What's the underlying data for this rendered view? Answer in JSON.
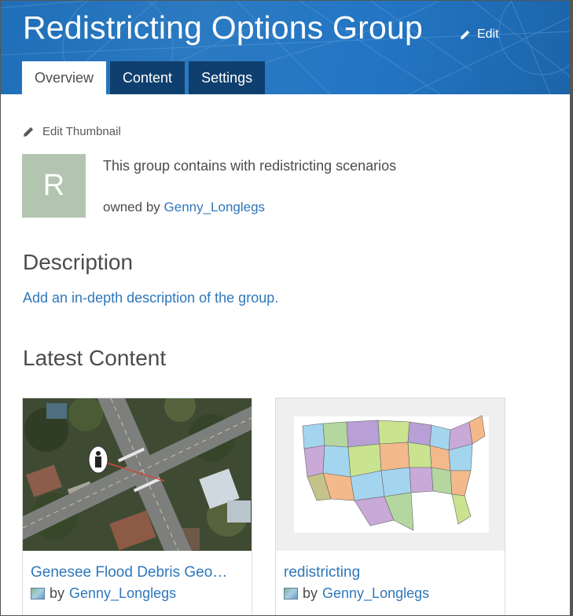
{
  "header": {
    "title": "Redistricting Options Group",
    "edit_label": "Edit",
    "tabs": [
      {
        "label": "Overview",
        "active": true
      },
      {
        "label": "Content",
        "active": false
      },
      {
        "label": "Settings",
        "active": false
      }
    ]
  },
  "overview": {
    "edit_thumbnail_label": "Edit Thumbnail",
    "thumbnail_letter": "R",
    "summary": "This group contains with redistricting scenarios",
    "owned_by_prefix": "owned by",
    "owner": "Genny_Longlegs"
  },
  "description": {
    "heading": "Description",
    "add_link": "Add an in-depth description of the group."
  },
  "latest_content": {
    "heading": "Latest Content",
    "items": [
      {
        "title": "Genesee Flood Debris Geo…",
        "by_prefix": "by",
        "owner": "Genny_Longlegs",
        "thumbnail": "aerial-imagery"
      },
      {
        "title": "redistricting",
        "by_prefix": "by",
        "owner": "Genny_Longlegs",
        "thumbnail": "us-map"
      }
    ]
  },
  "colors": {
    "header_blue": "#2376c4",
    "tab_dark": "#0f3f6e",
    "link_blue": "#2e77bc",
    "thumbnail_bg": "#b3c5b0"
  }
}
